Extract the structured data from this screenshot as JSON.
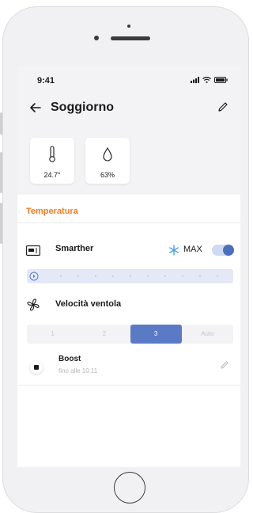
{
  "status_bar": {
    "time": "9:41"
  },
  "header": {
    "title": "Soggiorno"
  },
  "sensors": [
    {
      "icon": "thermometer-icon",
      "value": "24.7°"
    },
    {
      "icon": "humidity-drop-icon",
      "value": "63%"
    }
  ],
  "temperature_section": {
    "title": "Temperatura"
  },
  "smarther": {
    "icon": "thermostat-device-icon",
    "label": "Smarther",
    "mode_icon": "snowflake-icon",
    "mode_label": "MAX",
    "enabled": true
  },
  "fan": {
    "icon": "fan-icon",
    "label": "Velocità ventola",
    "options": [
      "1",
      "2",
      "3",
      "Auto"
    ],
    "selected": "3"
  },
  "boost": {
    "label": "Boost",
    "subtitle": "fino alle 10:11"
  },
  "colors": {
    "accent": "#ff7a1a",
    "primary": "#5a7ac6"
  }
}
